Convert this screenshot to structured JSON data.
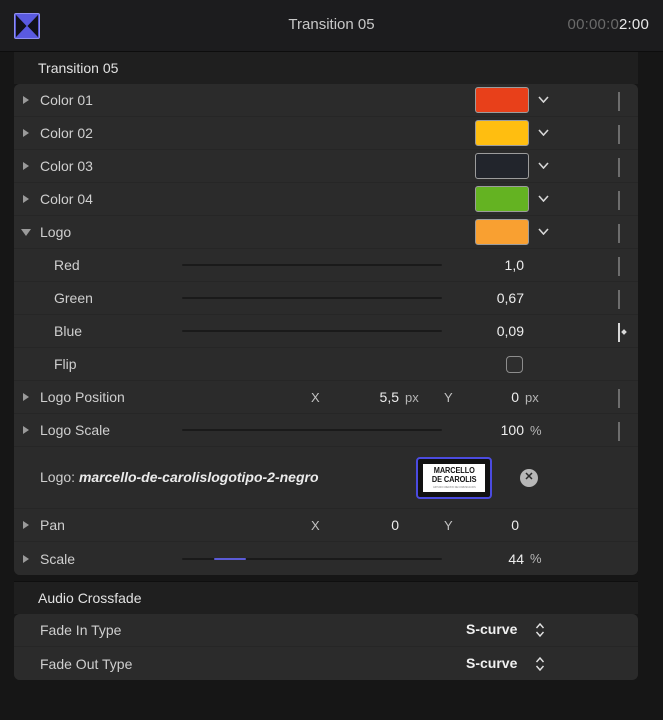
{
  "topbar": {
    "icon": "transition-bowtie-icon",
    "title": "Transition 05",
    "timecode_dim": "00:00:0",
    "timecode_active": "2:00"
  },
  "sections": [
    {
      "id": "transition",
      "title": "Transition 05"
    },
    {
      "id": "audio",
      "title": "Audio Crossfade"
    }
  ],
  "transition_rows": {
    "color01": {
      "label": "Color 01",
      "swatch": "#e8401a"
    },
    "color02": {
      "label": "Color 02",
      "swatch": "#ffbe10"
    },
    "color03": {
      "label": "Color 03",
      "swatch": "#22252c"
    },
    "color04": {
      "label": "Color 04",
      "swatch": "#64b322"
    },
    "logo": {
      "label": "Logo",
      "swatch": "#f9a031"
    },
    "red": {
      "label": "Red",
      "value": "1,0"
    },
    "green": {
      "label": "Green",
      "value": "0,67"
    },
    "blue": {
      "label": "Blue",
      "value": "0,09"
    },
    "flip": {
      "label": "Flip"
    },
    "logo_position": {
      "label": "Logo Position",
      "x_axis": "X",
      "x_value": "5,5",
      "x_unit": "px",
      "y_axis": "Y",
      "y_value": "0",
      "y_unit": "px"
    },
    "logo_scale": {
      "label": "Logo Scale",
      "value": "100",
      "unit": "%"
    },
    "logo_file": {
      "label": "Logo:",
      "filename": "marcello-de-carolislogotipo-2-negro",
      "thumb_line1": "MARCELLO",
      "thumb_line2": "DE CAROLIS",
      "thumb_line3": "ESTUDIO CREATIVO DE COMUNICACION",
      "clear": "✕"
    },
    "pan": {
      "label": "Pan",
      "x_axis": "X",
      "x_value": "0",
      "y_axis": "Y",
      "y_value": "0"
    },
    "scale": {
      "label": "Scale",
      "value": "44",
      "unit": "%"
    }
  },
  "audio_rows": {
    "fade_in": {
      "label": "Fade In Type",
      "value": "S-curve"
    },
    "fade_out": {
      "label": "Fade Out Type",
      "value": "S-curve"
    }
  }
}
